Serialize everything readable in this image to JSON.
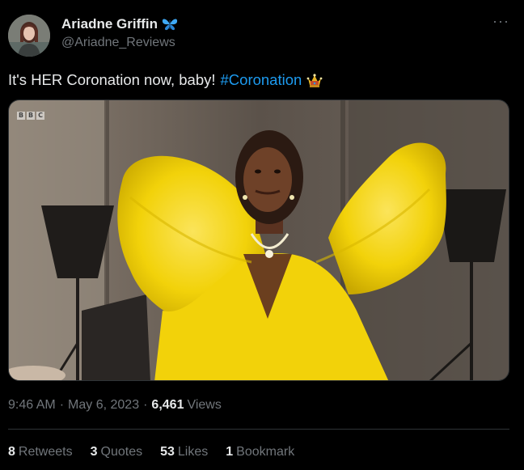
{
  "author": {
    "display_name": "Ariadne Griffin",
    "handle": "@Ariadne_Reviews",
    "badge_icon": "butterfly-emoji"
  },
  "tweet": {
    "text": "It's HER Coronation now, baby!",
    "hashtag": "#Coronation",
    "emoji_icon": "crown-emoji"
  },
  "media": {
    "watermark_letters": [
      "B",
      "B",
      "C"
    ]
  },
  "meta": {
    "time": "9:46 AM",
    "separator": "·",
    "date": "May 6, 2023",
    "views_count": "6,461",
    "views_label": "Views"
  },
  "stats": {
    "retweets": {
      "count": "8",
      "label": "Retweets"
    },
    "quotes": {
      "count": "3",
      "label": "Quotes"
    },
    "likes": {
      "count": "53",
      "label": "Likes"
    },
    "bookmarks": {
      "count": "1",
      "label": "Bookmark"
    }
  },
  "colors": {
    "background": "#000000",
    "text": "#e7e9ea",
    "secondary": "#71767b",
    "link": "#1d9bf0",
    "divider": "#2f3336",
    "dress_yellow": "#f2d20a"
  }
}
